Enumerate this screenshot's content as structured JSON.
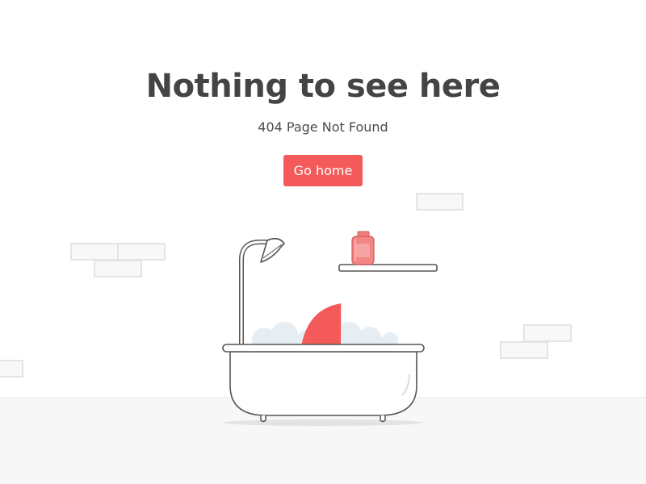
{
  "heading": "Nothing to see here",
  "subheading": "404 Page Not Found",
  "home_button": {
    "label": "Go home"
  },
  "colors": {
    "accent": "#f55a5a",
    "text": "#444444",
    "outline": "#555555",
    "brick_border": "#e4e4e4",
    "bubbles": "#e4ecf2",
    "floor": "#f7f7f7"
  },
  "icons": [
    "bathtub-icon",
    "shower-head-icon",
    "soap-bottle-icon",
    "shark-fin-icon"
  ]
}
